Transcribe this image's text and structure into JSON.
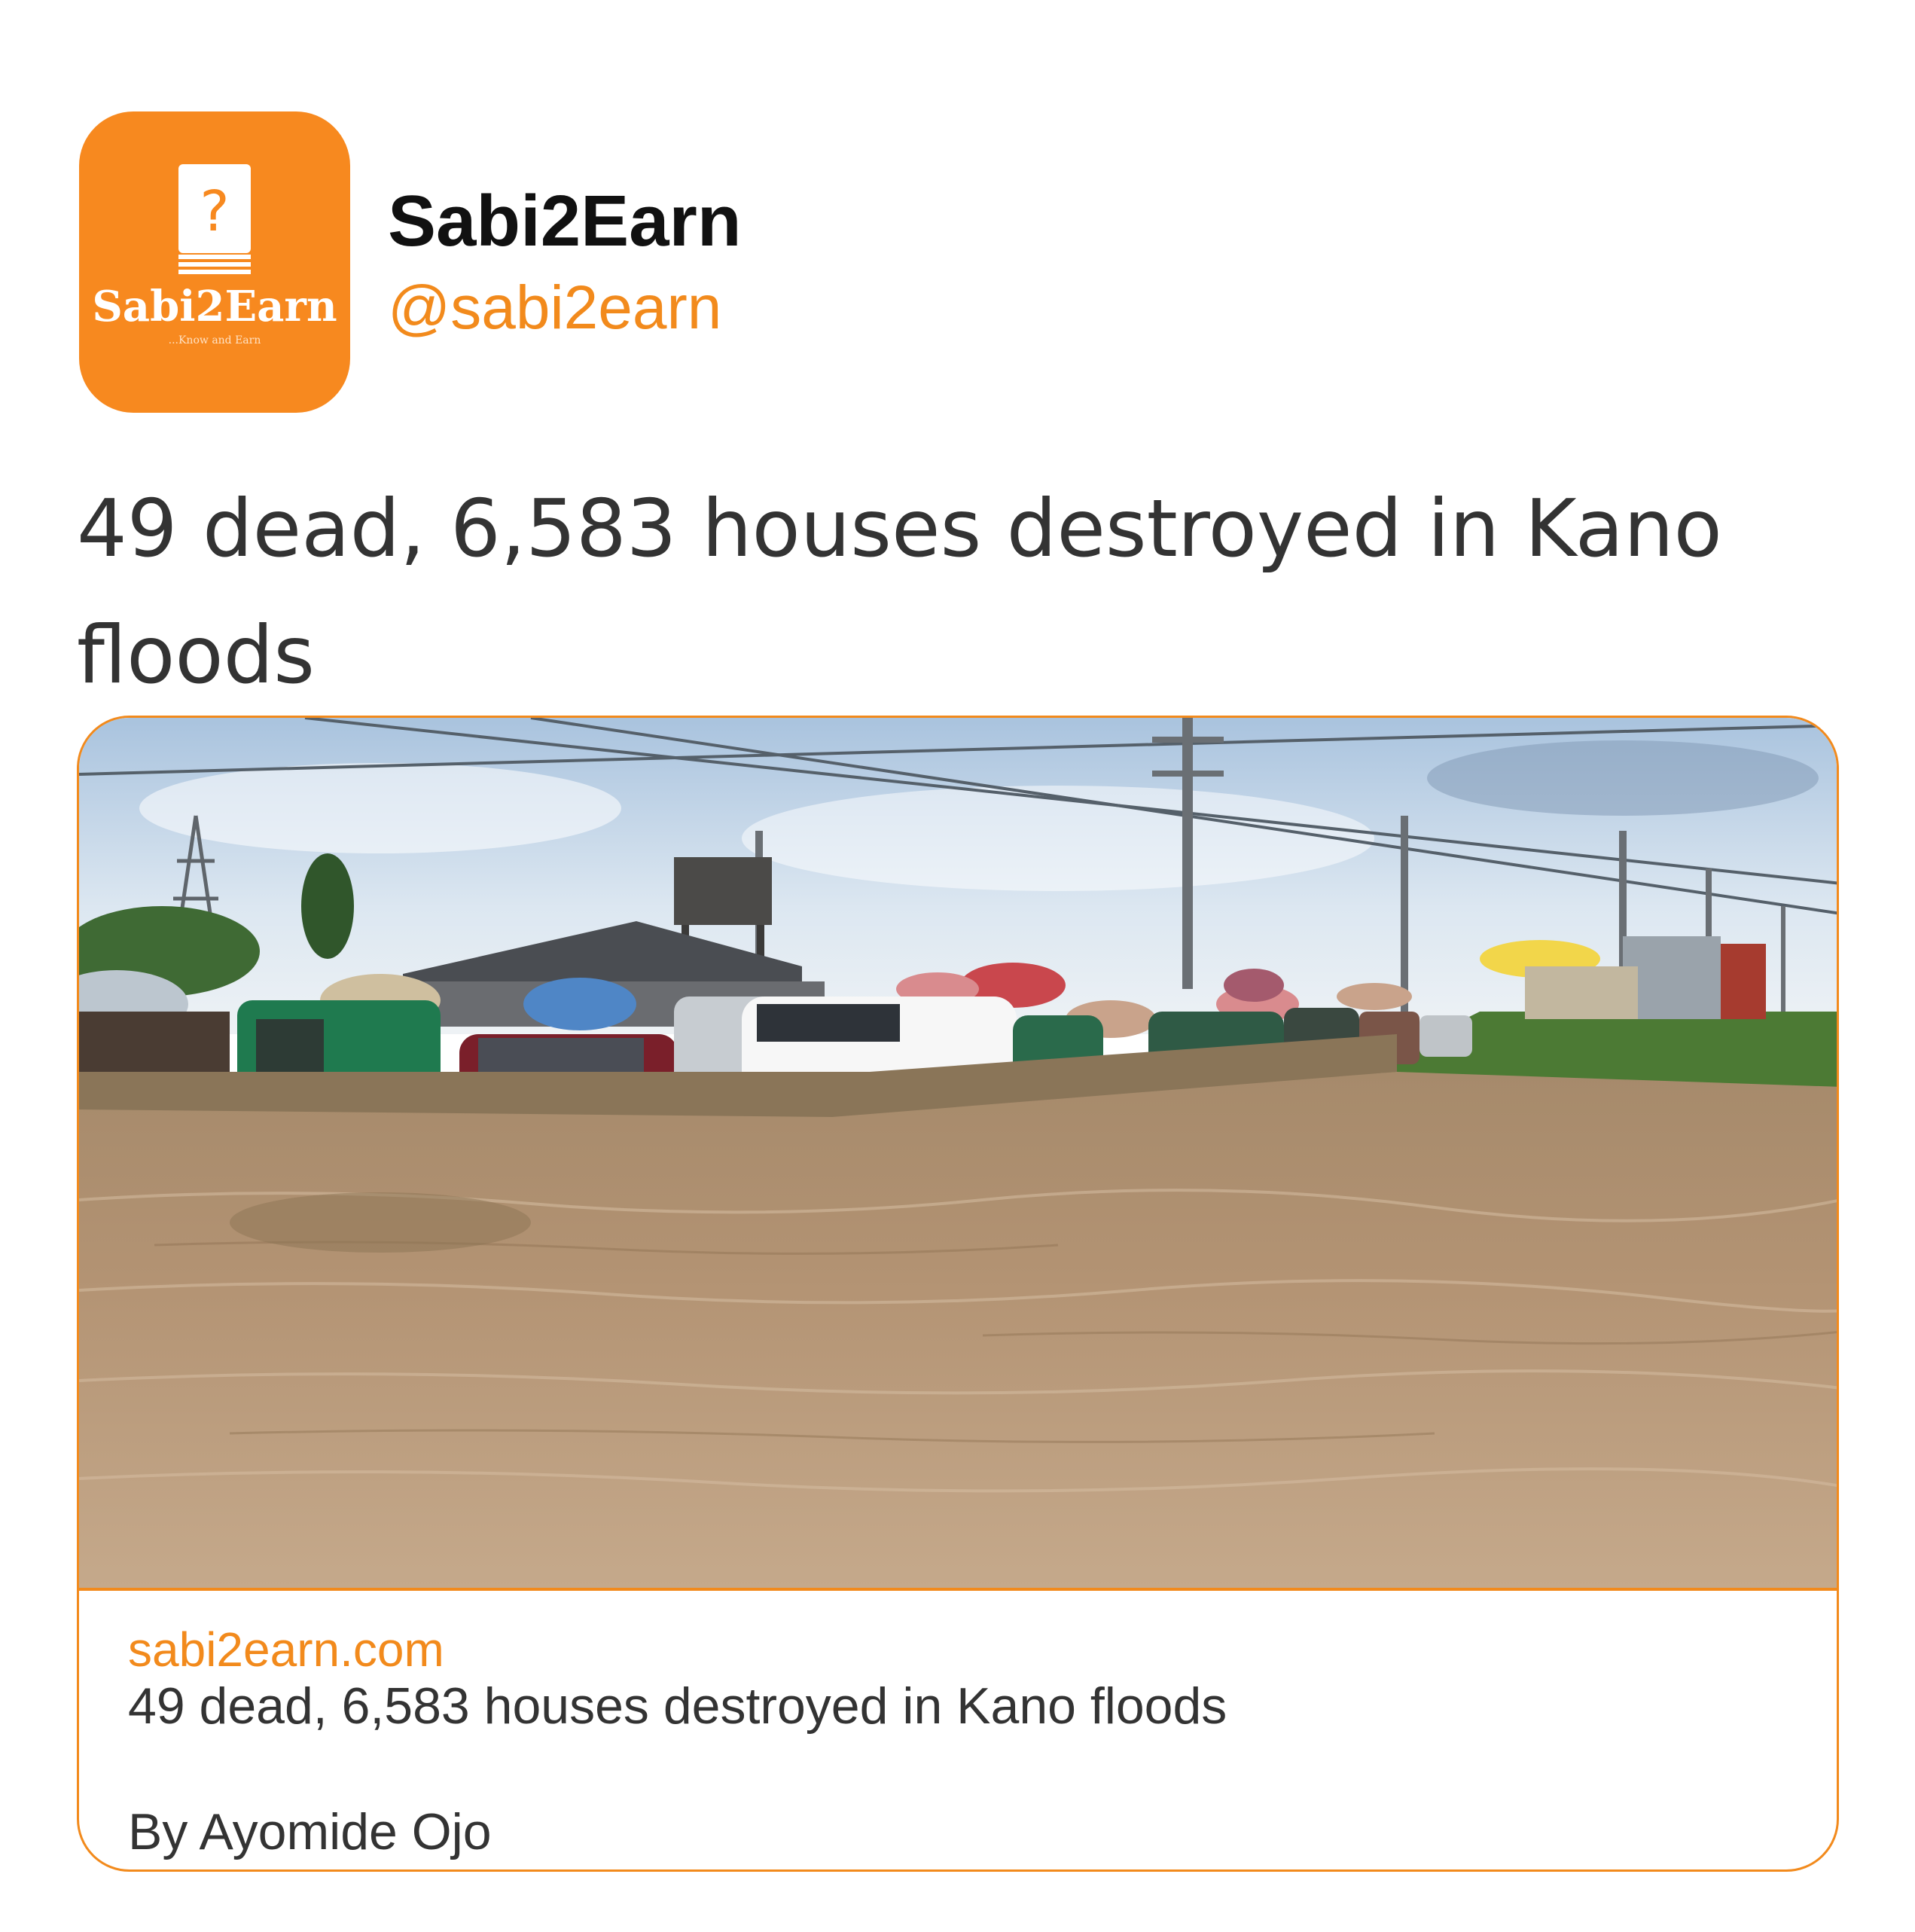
{
  "author": {
    "display_name": "Sabi2Earn",
    "handle": "@sabi2earn",
    "avatar": {
      "icon": "book-question-icon",
      "logo_text": "Sabi2Earn",
      "logo_tagline": "...Know and Earn",
      "brand_color": "#f7891f"
    }
  },
  "tweet": {
    "text": "49 dead, 6,583 houses destroyed in Kano floods"
  },
  "card": {
    "image_subject": "flooded-road-photo",
    "domain": "sabi2earn.com",
    "title": "49 dead, 6,583 houses destroyed in Kano floods",
    "description": "By Ayomide Ojo",
    "border_color": "#f28a1c"
  },
  "colors": {
    "accent": "#f28a1c",
    "text_primary": "#111111",
    "text_secondary": "#333333"
  }
}
